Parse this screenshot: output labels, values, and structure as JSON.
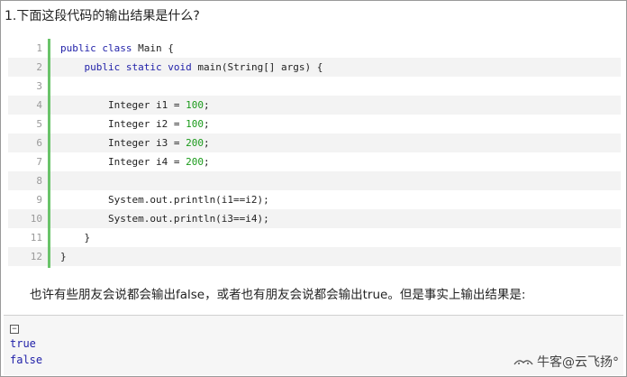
{
  "question": "1.下面这段代码的输出结果是什么?",
  "code": {
    "lines": [
      {
        "no": "1",
        "code": [
          {
            "t": "public class",
            "k": "kw"
          },
          {
            "t": " Main {",
            "k": ""
          }
        ]
      },
      {
        "no": "2",
        "code": [
          {
            "t": "    ",
            "k": ""
          },
          {
            "t": "public static void",
            "k": "kw"
          },
          {
            "t": " main(String[] args) {",
            "k": ""
          }
        ]
      },
      {
        "no": "3",
        "code": []
      },
      {
        "no": "4",
        "code": [
          {
            "t": "        Integer i1 = ",
            "k": ""
          },
          {
            "t": "100",
            "k": "num"
          },
          {
            "t": ";",
            "k": ""
          }
        ]
      },
      {
        "no": "5",
        "code": [
          {
            "t": "        Integer i2 = ",
            "k": ""
          },
          {
            "t": "100",
            "k": "num"
          },
          {
            "t": ";",
            "k": ""
          }
        ]
      },
      {
        "no": "6",
        "code": [
          {
            "t": "        Integer i3 = ",
            "k": ""
          },
          {
            "t": "200",
            "k": "num"
          },
          {
            "t": ";",
            "k": ""
          }
        ]
      },
      {
        "no": "7",
        "code": [
          {
            "t": "        Integer i4 = ",
            "k": ""
          },
          {
            "t": "200",
            "k": "num"
          },
          {
            "t": ";",
            "k": ""
          }
        ]
      },
      {
        "no": "8",
        "code": []
      },
      {
        "no": "9",
        "code": [
          {
            "t": "        System.out.println(i1==i2);",
            "k": ""
          }
        ]
      },
      {
        "no": "10",
        "code": [
          {
            "t": "        System.out.println(i3==i4);",
            "k": ""
          }
        ]
      },
      {
        "no": "11",
        "code": [
          {
            "t": "    }",
            "k": ""
          }
        ]
      },
      {
        "no": "12",
        "code": [
          {
            "t": "}",
            "k": ""
          }
        ]
      }
    ]
  },
  "explanation": "也许有些朋友会说都会输出false，或者也有朋友会说都会输出true。但是事实上输出结果是:",
  "output": {
    "collapse_symbol": "−",
    "lines": [
      "true",
      "false"
    ]
  },
  "watermark": {
    "text": "牛客@云飞扬°",
    "icon": "niuke-logo-icon"
  },
  "colors": {
    "keyword": "#1f1fa8",
    "number": "#1a9a1a",
    "gutter": "#6ac36a",
    "shade": "#f3f3f3"
  }
}
